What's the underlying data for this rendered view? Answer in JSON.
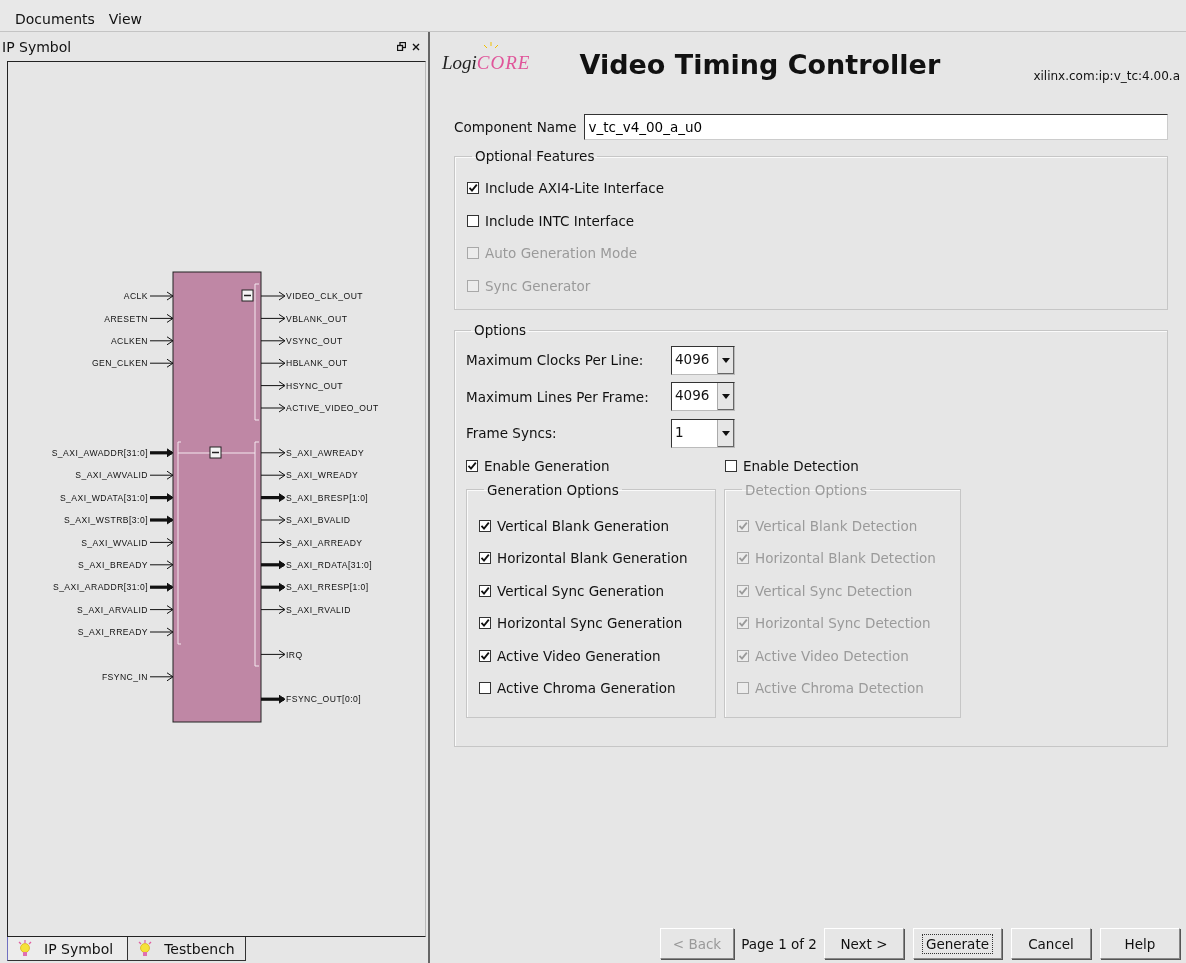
{
  "menu": [
    {
      "label": "Documents"
    },
    {
      "label": "View"
    }
  ],
  "ip_panel": {
    "title": "IP Symbol",
    "symbol": {
      "inputs": [
        {
          "name": "ACLK",
          "bus": false
        },
        {
          "name": "ARESETN",
          "bus": false
        },
        {
          "name": "ACLKEN",
          "bus": false
        },
        {
          "name": "GEN_CLKEN",
          "bus": false
        },
        {
          "name": "S_AXI_AWADDR[31:0]",
          "bus": true
        },
        {
          "name": "S_AXI_AWVALID",
          "bus": false
        },
        {
          "name": "S_AXI_WDATA[31:0]",
          "bus": true
        },
        {
          "name": "S_AXI_WSTRB[3:0]",
          "bus": true
        },
        {
          "name": "S_AXI_WVALID",
          "bus": false
        },
        {
          "name": "S_AXI_BREADY",
          "bus": false
        },
        {
          "name": "S_AXI_ARADDR[31:0]",
          "bus": true
        },
        {
          "name": "S_AXI_ARVALID",
          "bus": false
        },
        {
          "name": "S_AXI_RREADY",
          "bus": false
        },
        {
          "name": "FSYNC_IN",
          "bus": false
        }
      ],
      "outputs": [
        {
          "name": "VIDEO_CLK_OUT",
          "bus": false
        },
        {
          "name": "VBLANK_OUT",
          "bus": false
        },
        {
          "name": "VSYNC_OUT",
          "bus": false
        },
        {
          "name": "HBLANK_OUT",
          "bus": false
        },
        {
          "name": "HSYNC_OUT",
          "bus": false
        },
        {
          "name": "ACTIVE_VIDEO_OUT",
          "bus": false
        },
        {
          "name": "S_AXI_AWREADY",
          "bus": false
        },
        {
          "name": "S_AXI_WREADY",
          "bus": false
        },
        {
          "name": "S_AXI_BRESP[1:0]",
          "bus": true
        },
        {
          "name": "S_AXI_BVALID",
          "bus": false
        },
        {
          "name": "S_AXI_ARREADY",
          "bus": false
        },
        {
          "name": "S_AXI_RDATA[31:0]",
          "bus": true
        },
        {
          "name": "S_AXI_RRESP[1:0]",
          "bus": true
        },
        {
          "name": "S_AXI_RVALID",
          "bus": false
        },
        {
          "name": "IRQ",
          "bus": false
        },
        {
          "name": "FSYNC_OUT[0:0]",
          "bus": true
        }
      ]
    },
    "tabs": [
      {
        "label": "IP Symbol",
        "selected": true
      },
      {
        "label": "Testbench",
        "selected": false
      }
    ]
  },
  "wizard": {
    "logo": {
      "prefix": "Logi",
      "suffix": "CORE"
    },
    "title": "Video Timing Controller",
    "vlnv": "xilinx.com:ip:v_tc:4.00.a",
    "component_name": {
      "label": "Component Name",
      "value": "v_tc_v4_00_a_u0"
    },
    "optional_features": {
      "title": "Optional Features",
      "items": [
        {
          "label": "Include AXI4-Lite Interface",
          "checked": true,
          "disabled": false
        },
        {
          "label": "Include INTC Interface",
          "checked": false,
          "disabled": false
        },
        {
          "label": "Auto Generation Mode",
          "checked": false,
          "disabled": true
        },
        {
          "label": "Sync Generator",
          "checked": false,
          "disabled": true
        }
      ]
    },
    "options": {
      "title": "Options",
      "combos": [
        {
          "label": "Maximum Clocks Per Line:",
          "value": "4096"
        },
        {
          "label": "Maximum Lines Per Frame:",
          "value": "4096"
        },
        {
          "label": "Frame Syncs:",
          "value": "1"
        }
      ],
      "enable": [
        {
          "label": "Enable Generation",
          "checked": true,
          "disabled": false
        },
        {
          "label": "Enable Detection",
          "checked": false,
          "disabled": false
        }
      ],
      "groups": [
        {
          "title": "Generation Options",
          "disabled": false,
          "items": [
            {
              "label": "Vertical Blank Generation",
              "checked": true,
              "disabled": false
            },
            {
              "label": "Horizontal Blank Generation",
              "checked": true,
              "disabled": false
            },
            {
              "label": "Vertical Sync Generation",
              "checked": true,
              "disabled": false
            },
            {
              "label": "Horizontal Sync Generation",
              "checked": true,
              "disabled": false
            },
            {
              "label": "Active Video Generation",
              "checked": true,
              "disabled": false
            },
            {
              "label": "Active Chroma Generation",
              "checked": false,
              "disabled": false
            }
          ]
        },
        {
          "title": "Detection Options",
          "disabled": true,
          "items": [
            {
              "label": "Vertical Blank Detection",
              "checked": true,
              "disabled": true
            },
            {
              "label": "Horizontal Blank Detection",
              "checked": true,
              "disabled": true
            },
            {
              "label": "Vertical Sync Detection",
              "checked": true,
              "disabled": true
            },
            {
              "label": "Horizontal Sync Detection",
              "checked": true,
              "disabled": true
            },
            {
              "label": "Active Video Detection",
              "checked": true,
              "disabled": true
            },
            {
              "label": "Active Chroma Detection",
              "checked": false,
              "disabled": true
            }
          ]
        }
      ]
    },
    "footer": {
      "page_label": "Page 1 of 2",
      "buttons": [
        {
          "label": "< Back",
          "disabled": true,
          "focused": false
        },
        {
          "label": "Next >",
          "disabled": false,
          "focused": false
        },
        {
          "label": "Generate",
          "disabled": false,
          "focused": true
        },
        {
          "label": "Cancel",
          "disabled": false,
          "focused": false
        },
        {
          "label": "Help",
          "disabled": false,
          "focused": false
        }
      ]
    }
  }
}
